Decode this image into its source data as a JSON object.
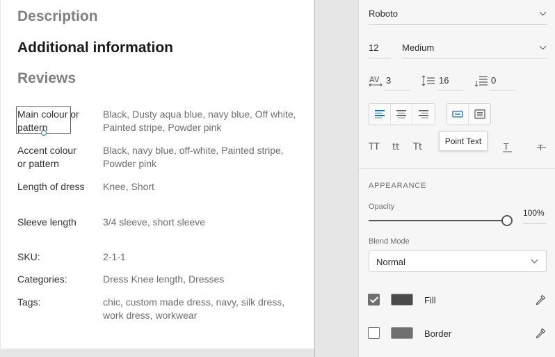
{
  "artboard": {
    "tabs": [
      {
        "label": "Description",
        "active": false
      },
      {
        "label": "Additional information",
        "active": true
      },
      {
        "label": "Reviews",
        "active": false
      }
    ],
    "attributes": [
      {
        "label": "Main colour or pattern",
        "value": "Black, Dusty aqua blue, navy blue, Off white, Painted stripe, Powder pink"
      },
      {
        "label": "Accent colour or pattern",
        "value": "Black, navy blue, off-white, Painted stripe, Powder pink"
      },
      {
        "label": "Length of dress",
        "value": "Knee, Short"
      },
      {
        "label": "Sleeve length",
        "value": "3/4 sleeve, short sleeve"
      }
    ],
    "meta": [
      {
        "label": "SKU:",
        "value": "2-1-1"
      },
      {
        "label": "Categories:",
        "value": "Dress Knee length, Dresses"
      },
      {
        "label": "Tags:",
        "value": "chic, custom made dress, navy, silk dress, work dress, workwear"
      }
    ]
  },
  "inspector": {
    "font_family": "Roboto",
    "font_size": "12",
    "font_weight": "Medium",
    "char_spacing": "3",
    "line_spacing": "16",
    "paragraph_spacing": "0",
    "tooltip": "Point Text",
    "case_options": [
      "TT",
      "tt",
      "Tt"
    ],
    "appearance": {
      "section_title": "APPEARANCE",
      "opacity_label": "Opacity",
      "opacity_value": "100%",
      "opacity_fraction": 1.0,
      "blend_label": "Blend Mode",
      "blend_value": "Normal",
      "fill_label": "Fill",
      "fill_checked": true,
      "fill_color": "#4a4a4a",
      "border_label": "Border",
      "border_checked": false,
      "border_color": "#707070"
    }
  },
  "colors": {
    "selection": "#1473b6"
  }
}
